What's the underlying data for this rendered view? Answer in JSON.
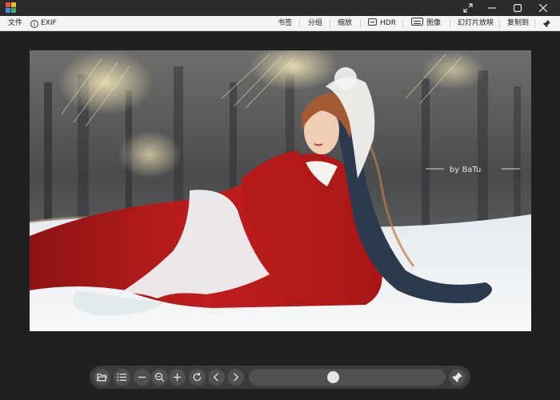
{
  "menu": {
    "file": "文件",
    "exif": "EXIF",
    "bookmark": "书签",
    "group": "分组",
    "zoom": "缩放",
    "hdr": "HDR",
    "image": "图像",
    "slideshow": "幻灯片放映",
    "copy_to": "复制到"
  },
  "photo": {
    "signature": "by   BaTu"
  },
  "toolbar": {
    "slider_position": 0.42
  },
  "colors": {
    "titlebar": "#2b2b2b",
    "menubar": "#f3f4f6",
    "toolbar": "#3b3b3b",
    "button": "#505050"
  }
}
